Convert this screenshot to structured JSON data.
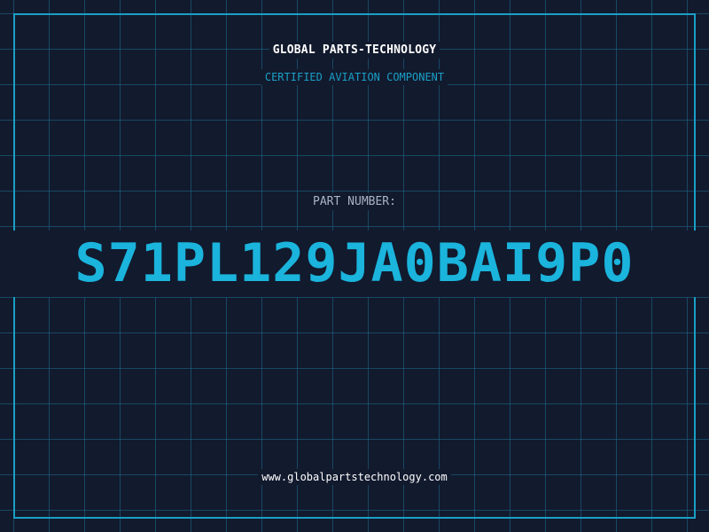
{
  "header": {
    "company": "GLOBAL PARTS-TECHNOLOGY",
    "subtitle": "CERTIFIED AVIATION COMPONENT"
  },
  "part": {
    "label": "PART NUMBER:",
    "number": "S71PL129JA0BAI9P0"
  },
  "footer": {
    "website": "www.globalpartstechnology.com"
  },
  "colors": {
    "background": "#121a2e",
    "grid": "#1e6e8c",
    "accent": "#1ab4dc",
    "border": "#1a9fc6",
    "label": "#a9b4c4",
    "text": "#ffffff"
  }
}
